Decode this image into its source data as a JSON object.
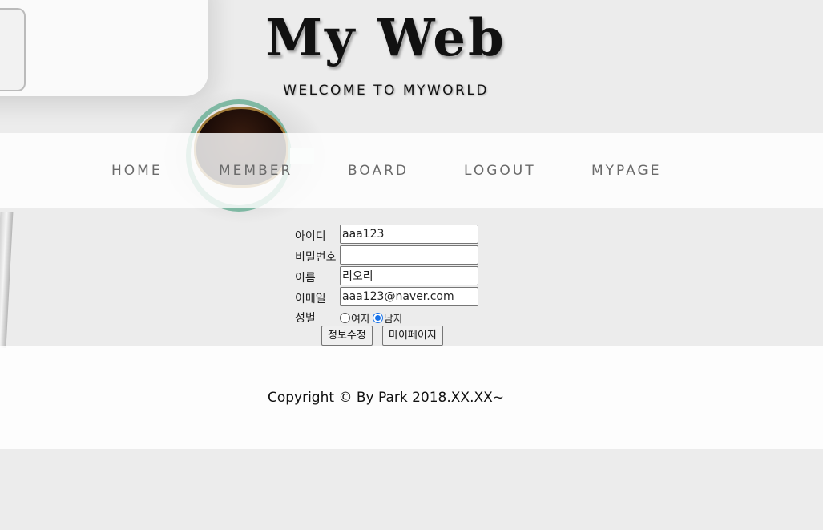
{
  "header": {
    "title": "My Web",
    "subtitle": "WELCOME TO MYWORLD"
  },
  "nav": {
    "items": [
      "HOME",
      "MEMBER",
      "BOARD",
      "LOGOUT",
      "MYPAGE"
    ]
  },
  "form": {
    "id_label": "아이디",
    "id_value": "aaa123",
    "password_label": "비밀번호",
    "password_value": "",
    "name_label": "이름",
    "name_value": "리오리",
    "email_label": "이메일",
    "email_value": "aaa123@naver.com",
    "gender_label": "성별",
    "gender_options": [
      "여자",
      "남자"
    ],
    "gender_selected": "남자",
    "update_button": "정보수정",
    "mypage_button": "마이페이지"
  },
  "footer": {
    "copyright": "Copyright © By Park 2018.XX.XX~"
  },
  "colors": {
    "background": "#ececec",
    "text": "#111111",
    "nav_text": "#6a6a6a",
    "radio_accent": "#1a73e8"
  }
}
